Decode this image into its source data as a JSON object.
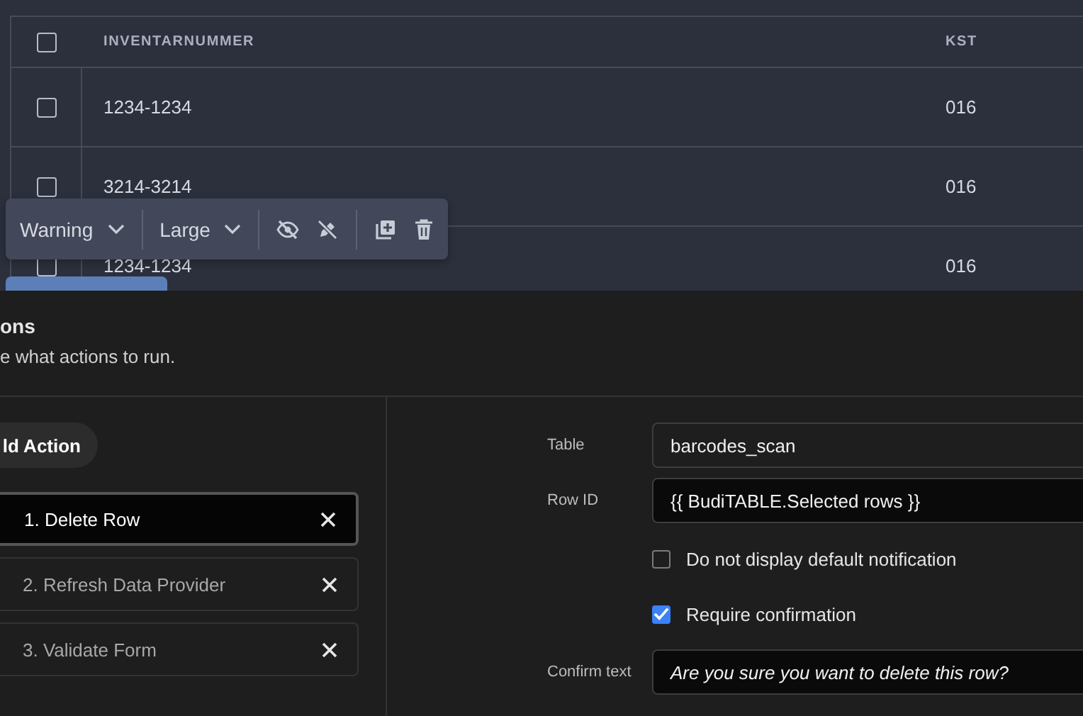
{
  "table": {
    "header_checked": false,
    "columns": [
      "INVENTARNUMMER",
      "KST"
    ],
    "rows": [
      {
        "cells": [
          "1234-1234",
          "016"
        ],
        "checked": false
      },
      {
        "cells": [
          "3214-3214",
          "016"
        ],
        "checked": false
      },
      {
        "cells": [
          "1234-1234",
          "016"
        ],
        "checked": false
      }
    ]
  },
  "toolbar": {
    "dropdowns": [
      "Warning",
      "Large"
    ]
  },
  "panel": {
    "title": "ons",
    "subtitle": "e what actions to run.",
    "add_button": "ld Action",
    "actions": [
      {
        "label": "1. Delete Row",
        "selected": true
      },
      {
        "label": "2. Refresh Data Provider",
        "selected": false
      },
      {
        "label": "3. Validate Form",
        "selected": false
      }
    ],
    "settings": [
      {
        "kind": "field",
        "label": "Table",
        "value": "barcodes_scan"
      },
      {
        "kind": "field",
        "label": "Row ID",
        "value": "{{ BudiTABLE.Selected rows }}"
      },
      {
        "kind": "checkbox",
        "label": "Do not display default notification",
        "checked": false
      },
      {
        "kind": "checkbox",
        "label": "Require confirmation",
        "checked": true
      },
      {
        "kind": "field",
        "label": "Confirm text",
        "value": "Are you sure you want to delete this row?"
      }
    ]
  }
}
